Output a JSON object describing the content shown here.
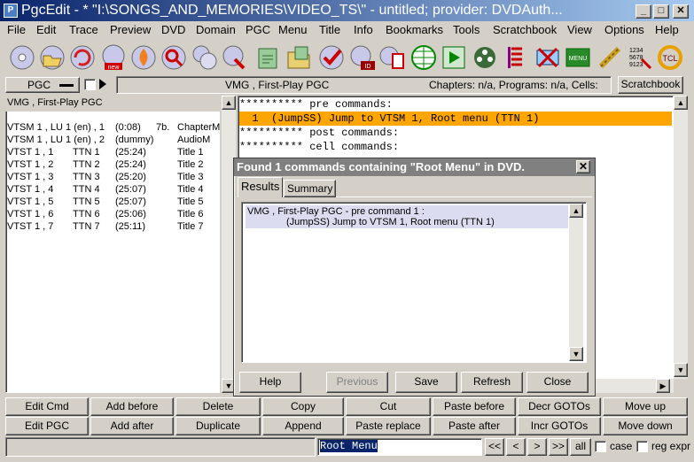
{
  "window": {
    "title": "PgcEdit - * \"I:\\SONGS_AND_MEMORIES\\VIDEO_TS\\\" - untitled; provider: DVDAuth...",
    "app_icon": "pgcedit-icon"
  },
  "menu": [
    "File",
    "Edit",
    "Trace",
    "Preview",
    "DVD",
    "Domain",
    "PGC",
    "Menu",
    "Title",
    "Info",
    "Bookmarks",
    "Tools",
    "Scratchbook",
    "View",
    "Options",
    "Help"
  ],
  "infobar": {
    "pgc_select": "PGC",
    "location": "VMG , First-Play PGC",
    "counts": "Chapters: n/a,  Programs: n/a,  Cells: n/a",
    "scratchbook": "Scratchbook"
  },
  "left_panel": {
    "header": "VMG , First-Play PGC",
    "rows": [
      [
        "VTSM 1 , LU 1 (en) , 1",
        "(0:08)",
        "7b.",
        "ChapterM"
      ],
      [
        "VTSM 1 , LU 1 (en) , 2",
        "(dummy)",
        "",
        "AudioM"
      ],
      [
        "VTST 1 , 1",
        "TTN 1",
        "(25:24)",
        "Title 1"
      ],
      [
        "VTST 1 , 2",
        "TTN 2",
        "(25:24)",
        "Title 2"
      ],
      [
        "VTST 1 , 3",
        "TTN 3",
        "(25:20)",
        "Title 3"
      ],
      [
        "VTST 1 , 4",
        "TTN 4",
        "(25:07)",
        "Title 4"
      ],
      [
        "VTST 1 , 5",
        "TTN 5",
        "(25:07)",
        "Title 5"
      ],
      [
        "VTST 1 , 6",
        "TTN 6",
        "(25:06)",
        "Title 6"
      ],
      [
        "VTST 1 , 7",
        "TTN 7",
        "(25:11)",
        "Title 7"
      ]
    ]
  },
  "code": {
    "pre_header": "********** pre commands:",
    "selected_line": "  1  (JumpSS) Jump to VTSM 1, Root menu (TTN 1)",
    "post_header": "********** post commands:",
    "cell_header": "********** cell commands:"
  },
  "dialog": {
    "title": "Found 1 commands containing \"Root Menu\" in DVD.",
    "tabs": [
      "Results",
      "Summary"
    ],
    "result_line1": "VMG , First-Play PGC   - pre command 1 :",
    "result_line2": "(JumpSS) Jump to VTSM 1, Root menu (TTN 1)",
    "buttons": [
      "Help",
      "Previous",
      "Save",
      "Refresh",
      "Close"
    ]
  },
  "bottom_buttons_row1": [
    "Edit Cmd",
    "Add before",
    "Delete",
    "Copy",
    "Cut",
    "Paste before",
    "Decr GOTOs",
    "Move up"
  ],
  "bottom_buttons_row2": [
    "Edit PGC",
    "Add after",
    "Duplicate",
    "Append",
    "Paste replace",
    "Paste after",
    "Incr GOTOs",
    "Move down"
  ],
  "search": {
    "value": "Root Menu",
    "nav": [
      "<<",
      "<",
      ">",
      ">>",
      "all"
    ],
    "case_label": "case",
    "regexp_label": "reg expr"
  },
  "colors": {
    "title_start": "#0a246a",
    "highlight": "#ffa500",
    "dialog_title": "#808080"
  }
}
